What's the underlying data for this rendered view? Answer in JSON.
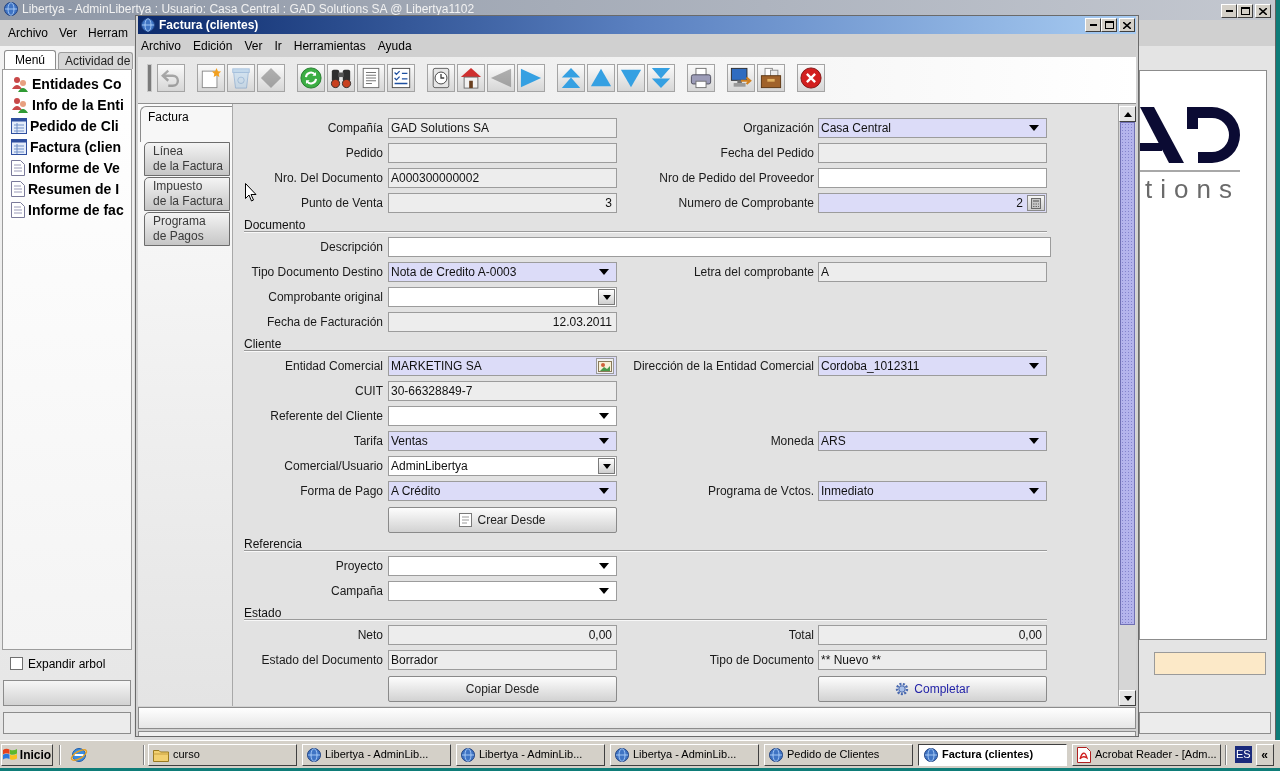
{
  "main_window": {
    "title": "Libertya - AdminLibertya : Usuario: Casa Central : GAD Solutions SA @ Libertya1102",
    "menu": [
      "Archivo",
      "Ver",
      "Herram"
    ],
    "tabs": [
      {
        "label": "Menú",
        "selected": true
      },
      {
        "label": "Actividad de",
        "selected": false
      }
    ],
    "tree": [
      {
        "label": "Entidades Co",
        "kind": "people"
      },
      {
        "label": "Info de la Enti",
        "kind": "people"
      },
      {
        "label": "Pedido de Cli",
        "kind": "window"
      },
      {
        "label": "Factura (clien",
        "kind": "window"
      },
      {
        "label": "Informe de Ve",
        "kind": "report"
      },
      {
        "label": "Resumen de I",
        "kind": "report"
      },
      {
        "label": "Informe de fac",
        "kind": "report"
      }
    ],
    "expand_tree": {
      "label": "Expandir arbol",
      "checked": false
    },
    "logo_text": "tions"
  },
  "invoice_window": {
    "title": "Factura (clientes)",
    "menu": [
      "Archivo",
      "Edición",
      "Ver",
      "Ir",
      "Herramientas",
      "Ayuda"
    ],
    "toolbar": [
      {
        "buttons": [
          {
            "kind": "undo",
            "disabled": true
          }
        ]
      },
      {
        "buttons": [
          {
            "kind": "new",
            "disabled": false
          },
          {
            "kind": "delete",
            "disabled": true
          },
          {
            "kind": "delete_selection",
            "disabled": true
          }
        ]
      },
      {
        "buttons": [
          {
            "kind": "refresh",
            "disabled": false
          },
          {
            "kind": "find",
            "disabled": false
          },
          {
            "kind": "attachment",
            "disabled": false
          },
          {
            "kind": "grid",
            "disabled": false
          }
        ]
      },
      {
        "buttons": [
          {
            "kind": "history",
            "disabled": false
          },
          {
            "kind": "home",
            "disabled": false
          },
          {
            "kind": "previous",
            "disabled": true
          },
          {
            "kind": "next",
            "disabled": false
          }
        ]
      },
      {
        "buttons": [
          {
            "kind": "first",
            "disabled": false
          },
          {
            "kind": "up",
            "disabled": false
          },
          {
            "kind": "down",
            "disabled": false
          },
          {
            "kind": "last",
            "disabled": false
          }
        ]
      },
      {
        "buttons": [
          {
            "kind": "print",
            "disabled": false
          }
        ]
      },
      {
        "buttons": [
          {
            "kind": "export",
            "disabled": false
          },
          {
            "kind": "archive",
            "disabled": false
          }
        ]
      },
      {
        "buttons": [
          {
            "kind": "close",
            "disabled": false
          }
        ]
      }
    ],
    "tabs": [
      {
        "label": "Factura",
        "selected": true
      },
      {
        "label": "Línea\nde la Factura",
        "selected": false
      },
      {
        "label": "Impuesto\nde la Factura",
        "selected": false
      },
      {
        "label": "Programa\nde Pagos",
        "selected": false
      }
    ],
    "sections": [
      {
        "rows": [
          {
            "fields": [
              {
                "label": "Compañía",
                "value": "GAD Solutions SA",
                "kind": "text",
                "read_only": true,
                "mandatory": false
              },
              {
                "label": "Organización",
                "value": "Casa Central",
                "kind": "combo",
                "read_only": false,
                "mandatory": true
              }
            ]
          },
          {
            "fields": [
              {
                "label": "Pedido",
                "kind": "text",
                "read_only": true,
                "mandatory": false
              },
              {
                "label": "Fecha del Pedido",
                "kind": "text",
                "read_only": true,
                "mandatory": false
              }
            ]
          },
          {
            "fields": [
              {
                "label": "Nro. Del Documento",
                "value": "A000300000002",
                "kind": "text",
                "read_only": true,
                "mandatory": false
              },
              {
                "label": "Nro de Pedido del Proveedor",
                "kind": "text",
                "read_only": false,
                "mandatory": false
              }
            ]
          },
          {
            "fields": [
              {
                "label": "Punto de Venta",
                "value": "3",
                "kind": "number",
                "read_only": true,
                "mandatory": false
              },
              {
                "label": "Numero de Comprobante",
                "value": "2",
                "kind": "calc_number",
                "read_only": false,
                "mandatory": true
              }
            ]
          }
        ]
      },
      {
        "heading": "Documento",
        "rows": [
          {
            "fields": [
              {
                "label": "Descripción",
                "kind": "long_text",
                "read_only": false,
                "mandatory": false
              }
            ]
          },
          {
            "fields": [
              {
                "label": "Tipo Documento Destino",
                "value": "Nota de Credito A-0003",
                "kind": "combo",
                "read_only": false,
                "mandatory": true
              },
              {
                "label": "Letra del comprobante",
                "value": "A",
                "kind": "text",
                "read_only": true,
                "mandatory": false
              }
            ]
          },
          {
            "fields": [
              {
                "label": "Comprobante original",
                "kind": "boxed_combo",
                "read_only": false,
                "mandatory": false
              }
            ]
          },
          {
            "fields": [
              {
                "label": "Fecha de Facturación",
                "value": "12.03.2011",
                "kind": "date",
                "read_only": true,
                "mandatory": false
              }
            ]
          }
        ]
      },
      {
        "heading": "Cliente",
        "rows": [
          {
            "fields": [
              {
                "label": "Entidad Comercial",
                "value": "MARKETING SA",
                "kind": "search",
                "read_only": false,
                "mandatory": true
              },
              {
                "label": "Dirección de la Entidad Comercial",
                "value": "Cordoba_1012311",
                "kind": "combo",
                "read_only": false,
                "mandatory": true
              }
            ]
          },
          {
            "fields": [
              {
                "label": "CUIT",
                "value": "30-66328849-7",
                "kind": "text",
                "read_only": true,
                "mandatory": false
              }
            ]
          },
          {
            "fields": [
              {
                "label": "Referente del Cliente",
                "kind": "combo",
                "read_only": false,
                "mandatory": false
              }
            ]
          },
          {
            "fields": [
              {
                "label": "Tarifa",
                "value": "Ventas",
                "kind": "combo",
                "read_only": false,
                "mandatory": true
              },
              {
                "label": "Moneda",
                "value": "ARS",
                "kind": "combo",
                "read_only": false,
                "mandatory": true
              }
            ]
          },
          {
            "fields": [
              {
                "label": "Comercial/Usuario",
                "value": "AdminLibertya",
                "kind": "boxed_combo",
                "read_only": false,
                "mandatory": false
              }
            ]
          },
          {
            "fields": [
              {
                "label": "Forma de Pago",
                "value": "A Crédito",
                "kind": "combo",
                "read_only": false,
                "mandatory": true
              },
              {
                "label": "Programa de Vctos.",
                "value": "Inmediato",
                "kind": "combo",
                "read_only": false,
                "mandatory": true
              }
            ]
          },
          {
            "fields": [
              {
                "label": "Crear Desde",
                "kind": "document_button"
              }
            ]
          }
        ]
      },
      {
        "heading": "Referencia",
        "rows": [
          {
            "fields": [
              {
                "label": "Proyecto",
                "kind": "combo",
                "read_only": false,
                "mandatory": false
              }
            ]
          },
          {
            "fields": [
              {
                "label": "Campaña",
                "kind": "combo",
                "read_only": false,
                "mandatory": false
              }
            ]
          }
        ]
      },
      {
        "heading": "Estado",
        "rows": [
          {
            "fields": [
              {
                "label": "Neto",
                "value": "0,00",
                "kind": "number",
                "read_only": true,
                "mandatory": false
              },
              {
                "label": "Total",
                "value": "0,00",
                "kind": "number",
                "read_only": true,
                "mandatory": false
              }
            ]
          },
          {
            "fields": [
              {
                "label": "Estado del Documento",
                "value": "Borrador",
                "kind": "text",
                "read_only": true,
                "mandatory": false
              },
              {
                "label": "Tipo de Documento",
                "value": "** Nuevo **",
                "kind": "text",
                "read_only": true,
                "mandatory": false
              }
            ]
          },
          {
            "fields": [
              {
                "label": "Copiar Desde",
                "kind": "button"
              },
              {
                "label": "Completar",
                "kind": "process_button"
              }
            ]
          }
        ]
      }
    ]
  },
  "taskbar": {
    "start": "Inicio",
    "tasks": [
      {
        "label": "curso",
        "kind": "folder",
        "selected": false
      },
      {
        "label": "Libertya - AdminLib...",
        "kind": "app",
        "selected": false
      },
      {
        "label": "Libertya - AdminLib...",
        "kind": "app",
        "selected": false
      },
      {
        "label": "Libertya - AdminLib...",
        "kind": "app",
        "selected": false
      },
      {
        "label": "Pedido de Clientes",
        "kind": "app",
        "selected": false
      },
      {
        "label": "Factura (clientes)",
        "kind": "app",
        "selected": true
      },
      {
        "label": "Acrobat Reader - [Adm...",
        "kind": "pdf",
        "selected": false
      }
    ],
    "language": "ES",
    "expand": "«"
  }
}
